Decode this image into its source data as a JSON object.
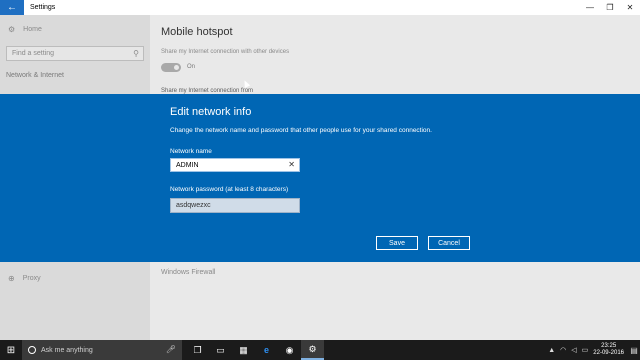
{
  "window": {
    "app_title": "Settings",
    "back_glyph": "←",
    "minimize_glyph": "—",
    "maximize_glyph": "❐",
    "close_glyph": "✕"
  },
  "sidebar": {
    "home_label": "Home",
    "search_placeholder": "Find a setting",
    "section_label": "Network & Internet",
    "proxy_label": "Proxy"
  },
  "main": {
    "title": "Mobile hotspot",
    "share_text": "Share my Internet connection with other devices",
    "toggle_state": "On",
    "share_from_label": "Share my Internet connection from",
    "firewall_link": "Windows Firewall"
  },
  "dialog": {
    "title": "Edit network info",
    "description": "Change the network name and password that other people use for your shared connection.",
    "name_label": "Network name",
    "name_value": "ADMIN",
    "password_label": "Network password (at least 8 characters)",
    "password_value": "asdqwezxc",
    "save_label": "Save",
    "cancel_label": "Cancel"
  },
  "taskbar": {
    "search_placeholder": "Ask me anything",
    "time": "23:25",
    "date": "22-09-2016",
    "icons": [
      "task-view-icon",
      "file-explorer-icon",
      "store-icon",
      "edge-icon",
      "chrome-icon",
      "settings-icon"
    ]
  },
  "colors": {
    "accent": "#0066b4",
    "taskbar": "#1b1b1b"
  }
}
